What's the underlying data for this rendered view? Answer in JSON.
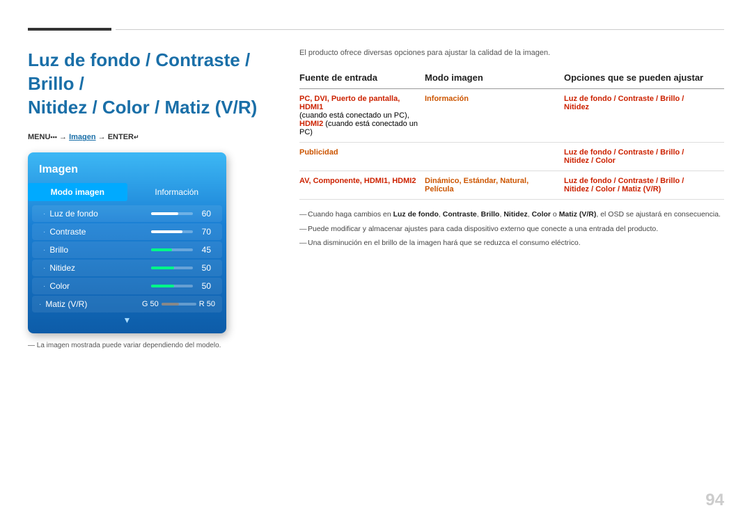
{
  "top": {
    "lines": "decorative"
  },
  "left": {
    "title": "Luz de fondo / Contraste / Brillo / \nNitidez / Color / Matiz (V/R)",
    "menu_instruction": "MENU  → Imagen → ENTER ",
    "panel": {
      "title": "Imagen",
      "tabs": [
        {
          "label": "Modo imagen",
          "active": true
        },
        {
          "label": "Información",
          "active": false
        }
      ],
      "items": [
        {
          "label": "Luz de fondo",
          "value": "60",
          "fill_pct": 65,
          "color": "white"
        },
        {
          "label": "Contraste",
          "value": "70",
          "fill_pct": 75,
          "color": "white"
        },
        {
          "label": "Brillo",
          "value": "45",
          "fill_pct": 50,
          "color": "green"
        },
        {
          "label": "Nitidez",
          "value": "50",
          "fill_pct": 55,
          "color": "green"
        },
        {
          "label": "Color",
          "value": "50",
          "fill_pct": 55,
          "color": "green"
        },
        {
          "label": "Matiz (V/R)",
          "g_value": "G 50",
          "r_value": "R 50",
          "fill_pct": 50
        }
      ]
    },
    "image_note": "— La imagen mostrada puede variar dependiendo del modelo."
  },
  "right": {
    "intro": "El producto ofrece diversas opciones para ajustar la calidad de la imagen.",
    "table": {
      "headers": [
        "Fuente de entrada",
        "Modo imagen",
        "Opciones que se pueden ajustar"
      ],
      "rows": [
        {
          "source": "PC, DVI, Puerto de pantalla, HDMI1\n(cuando está conectado un PC),\nHDMI2 (cuando está conectado un PC)",
          "source_colored": "PC, DVI, Puerto de pantalla, HDMI1",
          "source_plain1": "(cuando está conectado un PC),",
          "source_hdmi2": "HDMI2",
          "source_plain2": "(cuando está conectado un PC)",
          "mode": "Información",
          "options": "Luz de fondo / Contraste / Brillo / Nitidez",
          "options_colored": "Luz de fondo / Contraste / Brillo /",
          "options_nitidez": "Nitidez"
        },
        {
          "source": "Publicidad",
          "source_colored": "Publicidad",
          "mode": "",
          "options": "Luz de fondo / Contraste / Brillo / Nitidez / Color",
          "options_colored": "Luz de fondo / Contraste / Brillo /",
          "options_rest": "Nitidez / Color"
        },
        {
          "source": "AV, Componente, HDMI1, HDMI2",
          "source_colored": "AV, Componente, HDMI1, HDMI2",
          "mode": "Dinámico, Estándar, Natural, Película",
          "options": "Luz de fondo / Contraste / Brillo / Nitidez / Color / Matiz (V/R)",
          "options_colored": "Luz de fondo / Contraste / Brillo /",
          "options_rest": "Nitidez / Color / Matiz (V/R)"
        }
      ]
    },
    "notes": [
      {
        "text": "Cuando haga cambios en Luz de fondo, Contraste, Brillo, Nitidez, Color o Matiz (V/R), el OSD se ajustará en consecuencia."
      },
      {
        "text": "Puede modificar y almacenar ajustes para cada dispositivo externo que conecte a una entrada del producto."
      },
      {
        "text": "Una disminución en el brillo de la imagen hará que se reduzca el consumo eléctrico."
      }
    ]
  },
  "page_number": "94"
}
